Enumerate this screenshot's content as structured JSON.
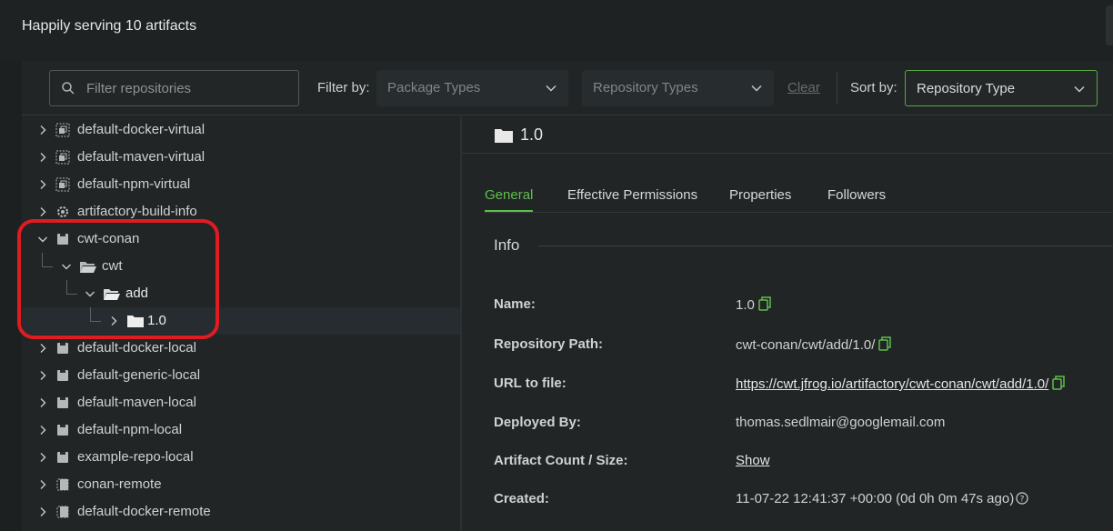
{
  "header": {
    "title": "Happily serving 10 artifacts"
  },
  "filters": {
    "search_placeholder": "Filter repositories",
    "filter_by_label": "Filter by:",
    "package_types": "Package Types",
    "repository_types": "Repository Types",
    "clear_label": "Clear",
    "sort_by_label": "Sort by:",
    "sort_value": "Repository Type"
  },
  "tree": {
    "items": [
      {
        "label": "default-docker-virtual",
        "icon": "virtual-repo-icon"
      },
      {
        "label": "default-maven-virtual",
        "icon": "virtual-repo-icon"
      },
      {
        "label": "default-npm-virtual",
        "icon": "virtual-repo-icon"
      },
      {
        "label": "artifactory-build-info",
        "icon": "build-info-icon"
      },
      {
        "label": "cwt-conan",
        "icon": "local-repo-icon",
        "expanded": true
      },
      {
        "label": "cwt",
        "icon": "folder-open-icon",
        "expanded": true
      },
      {
        "label": "add",
        "icon": "folder-open-icon",
        "expanded": true
      },
      {
        "label": "1.0",
        "icon": "folder-icon",
        "selected": true
      },
      {
        "label": "default-docker-local",
        "icon": "local-repo-icon"
      },
      {
        "label": "default-generic-local",
        "icon": "local-repo-icon"
      },
      {
        "label": "default-maven-local",
        "icon": "local-repo-icon"
      },
      {
        "label": "default-npm-local",
        "icon": "local-repo-icon"
      },
      {
        "label": "example-repo-local",
        "icon": "local-repo-icon"
      },
      {
        "label": "conan-remote",
        "icon": "remote-repo-icon"
      },
      {
        "label": "default-docker-remote",
        "icon": "remote-repo-icon"
      }
    ]
  },
  "detail": {
    "name": "1.0",
    "tabs": [
      "General",
      "Effective Permissions",
      "Properties",
      "Followers"
    ],
    "active_tab": "General",
    "section_title": "Info",
    "info": [
      {
        "key": "Name:",
        "value": "1.0"
      },
      {
        "key": "Repository Path:",
        "value": "cwt-conan/cwt/add/1.0/"
      },
      {
        "key": "URL to file:",
        "value": "https://cwt.jfrog.io/artifactory/cwt-conan/cwt/add/1.0/"
      },
      {
        "key": "Deployed By:",
        "value": "thomas.sedlmair@googlemail.com"
      },
      {
        "key": "Artifact Count / Size:",
        "value": "Show"
      },
      {
        "key": "Created:",
        "value": "11-07-22 12:41:37 +00:00 (0d 0h 0m 47s ago)"
      }
    ]
  },
  "colors": {
    "accent": "#5fbf4a",
    "highlight": "#e01b22",
    "background": "#212526"
  }
}
